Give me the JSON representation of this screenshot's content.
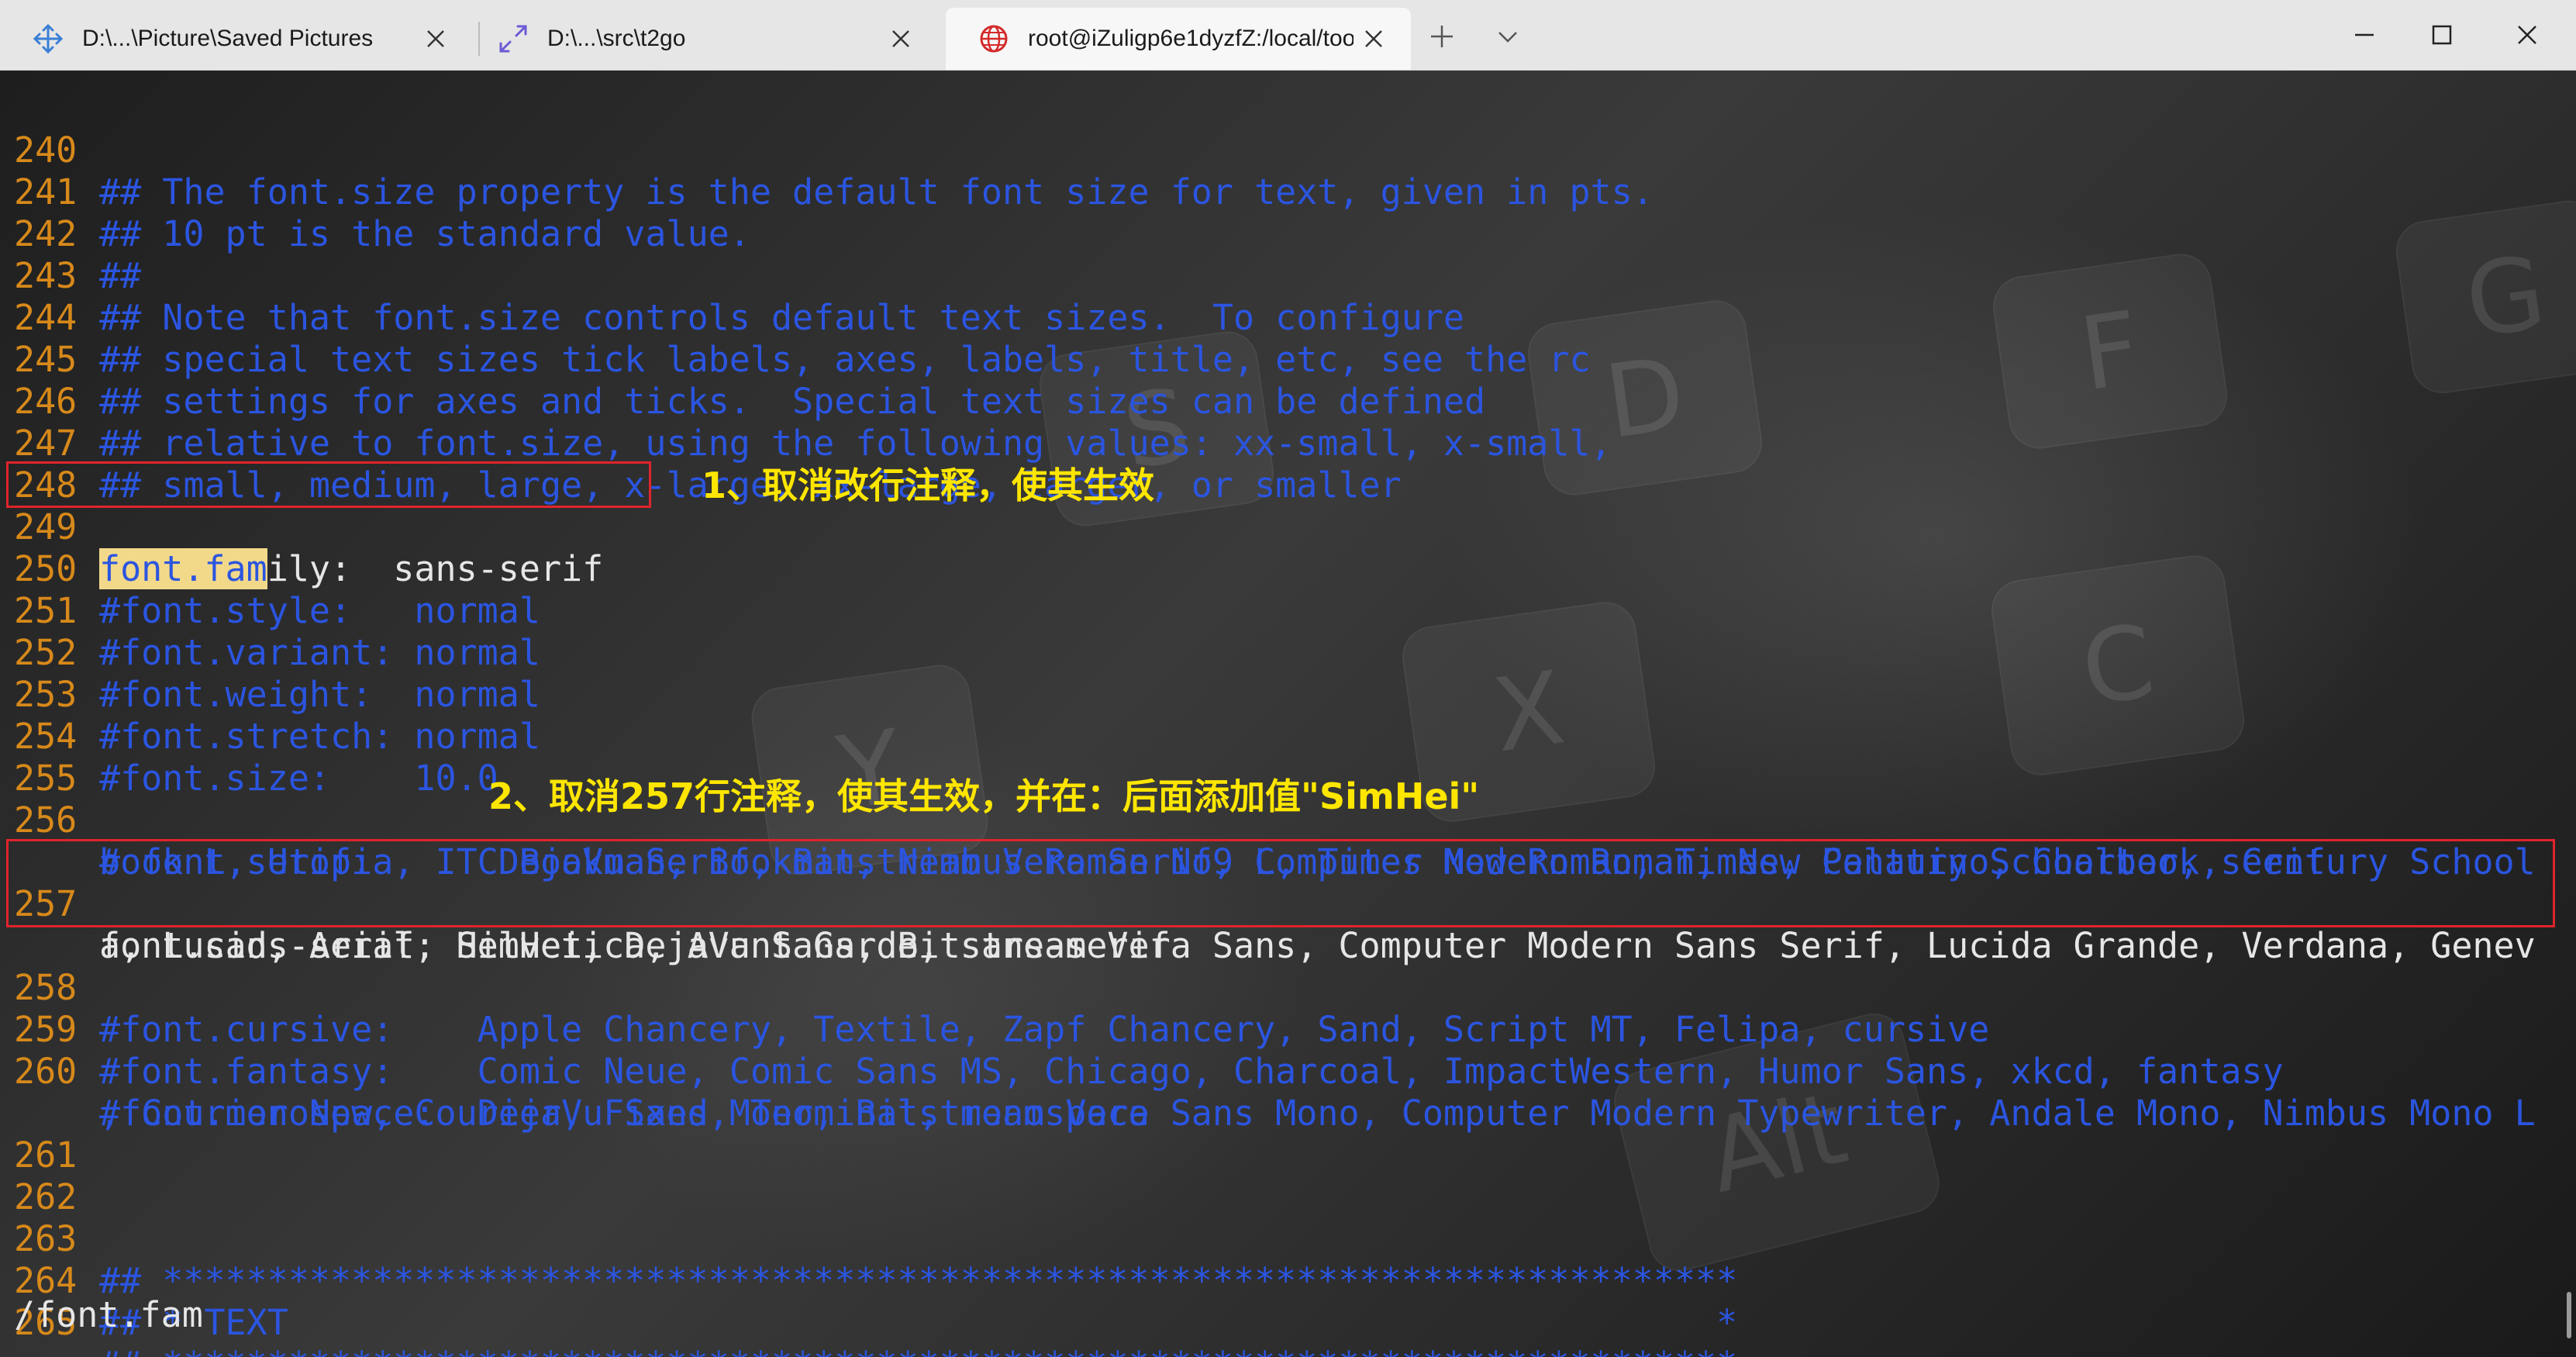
{
  "tabs": [
    {
      "title": "D:\\...\\Picture\\Saved Pictures",
      "icon": "move-icon"
    },
    {
      "title": "D:\\...\\src\\t2go",
      "icon": "expand-arrows-icon"
    },
    {
      "title": "root@iZuligp6e1dyzfZ:/local/too",
      "icon": "globe-icon"
    }
  ],
  "lines": [
    {
      "num": "240",
      "text": "## The font.size property is the default font size for text, given in pts."
    },
    {
      "num": "241",
      "text": "## 10 pt is the standard value."
    },
    {
      "num": "242",
      "text": "##"
    },
    {
      "num": "243",
      "text": "## Note that font.size controls default text sizes.  To configure"
    },
    {
      "num": "244",
      "text": "## special text sizes tick labels, axes, labels, title, etc, see the rc"
    },
    {
      "num": "245",
      "text": "## settings for axes and ticks.  Special text sizes can be defined"
    },
    {
      "num": "246",
      "text": "## relative to font.size, using the following values: xx-small, x-small,"
    },
    {
      "num": "247",
      "text": "## small, medium, large, x-large, xx-large, larger, or smaller"
    },
    {
      "num": "248",
      "text": ""
    },
    {
      "num": "249",
      "match": "font.fam",
      "text": "ily:  sans-serif"
    },
    {
      "num": "250",
      "text": "#font.style:   normal"
    },
    {
      "num": "251",
      "text": "#font.variant: normal"
    },
    {
      "num": "252",
      "text": "#font.weight:  normal"
    },
    {
      "num": "253",
      "text": "#font.stretch: normal"
    },
    {
      "num": "254",
      "text": "#font.size:    10.0"
    },
    {
      "num": "255",
      "text": ""
    },
    {
      "num": "256",
      "text": "# font.serif:      DejaVu Serif, Bitstream Vera Serif, Computer Modern Roman, New Century Schoolbook, Century School",
      "text2": "book L, Utopia, ITC Bookman, Bookman, Nimbus Roman No9 L, Times New Roman, Times, Palatino, Charter, serif"
    },
    {
      "num": "257",
      "text": "font.sans-serif: SimHei, DejaVu Sans, Bitstream Vera Sans, Computer Modern Sans Serif, Lucida Grande, Verdana, Genev",
      "text2": "a, Lucid, Arial, Helvetica, Avant Garde, sans-serif"
    },
    {
      "num": "258",
      "text": "#font.cursive:    Apple Chancery, Textile, Zapf Chancery, Sand, Script MT, Felipa, cursive"
    },
    {
      "num": "259",
      "text": "#font.fantasy:    Comic Neue, Comic Sans MS, Chicago, Charcoal, ImpactWestern, Humor Sans, xkcd, fantasy"
    },
    {
      "num": "260",
      "text": "#font.monospace:  DejaVu Sans Mono, Bitstream Vera Sans Mono, Computer Modern Typewriter, Andale Mono, Nimbus Mono L",
      "text2": ", Courier New, Courier, Fixed, Terminal, monospace"
    },
    {
      "num": "261",
      "text": ""
    },
    {
      "num": "262",
      "text": ""
    },
    {
      "num": "263",
      "text": "## ***************************************************************************"
    },
    {
      "num": "264",
      "text": "## * TEXT                                                                    *"
    },
    {
      "num": "265",
      "text": "## ***************************************************************************"
    }
  ],
  "annotations": {
    "note1": "1、取消改行注释，使其生效",
    "note2": "2、取消257行注释，使其生效，并在：后面添加值\"SimHei\""
  },
  "command_line": "/font.fam",
  "background_keys": [
    "Y",
    "X",
    "C",
    "S",
    "D",
    "F",
    "G",
    "Alt"
  ],
  "colors": {
    "line_number": "#d7891a",
    "comment": "#2b55e0",
    "normal_text": "#e6e6e6",
    "annotation": "#ffe600",
    "highlight_box": "#e0242b",
    "search_match": "#f2d98a"
  }
}
